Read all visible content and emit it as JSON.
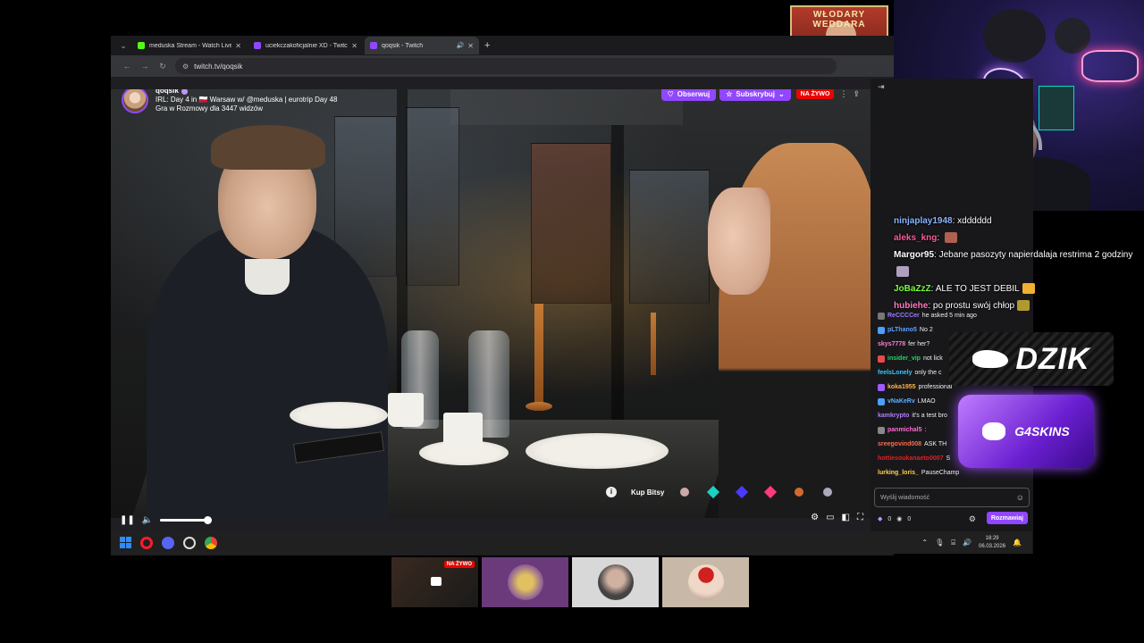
{
  "browser": {
    "tabs": [
      {
        "label": "meduska Stream - Watch Live o",
        "favicon_color": "#53fc18",
        "active": false,
        "speaker": false
      },
      {
        "label": "uciekczakoficjalnie XD - Twitch",
        "favicon_color": "#9147ff",
        "active": false,
        "speaker": false
      },
      {
        "label": "qoqsik - Twitch",
        "favicon_color": "#9147ff",
        "active": true,
        "speaker": true
      }
    ],
    "new_tab": "+",
    "url": "twitch.tv/qoqsik"
  },
  "stream": {
    "channel": "qoqsik",
    "title": "IRL: Day 4 in 🇵🇱 Warsaw w/ @meduska | eurotrip Day 48",
    "subtitle": "Gra w Rozmowy dla 3447 widzów",
    "follow_label": "Obserwuj",
    "subscribe_label": "Subskrybuj",
    "live_label": "NA ŻYWO",
    "bits_label": "Kup Bitsy",
    "volume_fraction": 0.95
  },
  "chat": {
    "messages": [
      {
        "user": "ReCCCCer",
        "text": "he asked 5 min ago",
        "color": "#9a7cff",
        "badge": "#777"
      },
      {
        "user": "pLThano5",
        "text": "No 2",
        "color": "#5aa0ff",
        "badge": "#4aa0ff"
      },
      {
        "user": "skys7778",
        "text": "fer her?",
        "color": "#ff7bd0",
        "badge": ""
      },
      {
        "user": "insider_vip",
        "text": "not lick",
        "color": "#1ed760",
        "badge": "#e84a4a"
      },
      {
        "user": "feelsLonely",
        "text": "only the c",
        "color": "#30c9ff",
        "badge": ""
      },
      {
        "user": "koka1955",
        "text": "professional",
        "color": "#ffb34a",
        "badge": "#a05aff"
      },
      {
        "user": "vNaKeRv",
        "text": "LMAO",
        "color": "#5ab0ff",
        "badge": "#4aa0ff"
      },
      {
        "user": "kamkrypto",
        "text": "it's a test bro",
        "color": "#b07cff",
        "badge": ""
      },
      {
        "user": "panmichal5",
        "text": ":",
        "color": "#ff6ad0",
        "badge": "#888"
      },
      {
        "user": "sreegovind008",
        "text": "ASK TH",
        "color": "#ff6a4a",
        "badge": ""
      },
      {
        "user": "hottiesoukanaeto0007",
        "text": "S",
        "color": "#e02020",
        "badge": ""
      },
      {
        "user": "lurking_loris_",
        "text": "PauseChamp",
        "color": "#ffd24a",
        "badge": ""
      }
    ],
    "input_placeholder": "Wyślij wiadomość",
    "points_a": "0",
    "points_b": "0",
    "send_label": "Rozmawiaj"
  },
  "overlay_chat": [
    {
      "user": "ninjaplay1948",
      "text": "xdddddd",
      "color": "#8ab4ff",
      "emote": ""
    },
    {
      "user": "aleks_kng",
      "text": "",
      "color": "#ff5a9a",
      "emote": "#b06050"
    },
    {
      "user": "Margor95",
      "text": "Jebane pasozyty napierdalaja restrima 2 godziny",
      "color": "#ffffff",
      "emote": "#b0a0c0"
    },
    {
      "user": "JoBaZzZ",
      "text": "ALE TO JEST DEBIL",
      "color": "#7cff3a",
      "emote": "#f0b030"
    },
    {
      "user": "hubiehe",
      "text": "po prostu swój chłop",
      "color": "#ff7bc0",
      "emote": "#b09a30"
    }
  ],
  "brand": {
    "top_logo": "WŁODARY WEDDARA",
    "dzik": "DZIK",
    "g4skins": "G4SKINS"
  },
  "taskbar": {
    "time": "18:29",
    "date": "06.03.2026"
  },
  "thumbnails": {
    "live_label": "NA ŻYWO"
  }
}
